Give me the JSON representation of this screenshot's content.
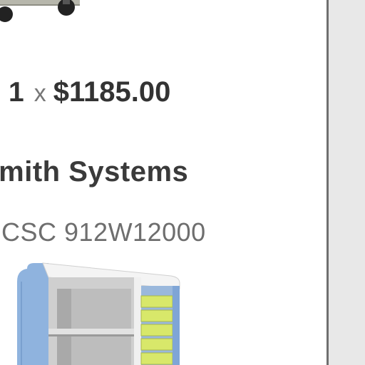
{
  "cart_item": {
    "quantity": "1",
    "times_symbol": "x",
    "unit_price": "$1185.00"
  },
  "product": {
    "brand": "Smith Systems",
    "sku": "CSC 912W12000"
  },
  "colors": {
    "text_dark": "#333333",
    "text_muted": "#6e6e6e",
    "divider": "#6f6f6f",
    "right_panel": "#e8e8e8",
    "cabinet_blue": "#8fb3de",
    "tray_yellow": "#d8e86a"
  }
}
